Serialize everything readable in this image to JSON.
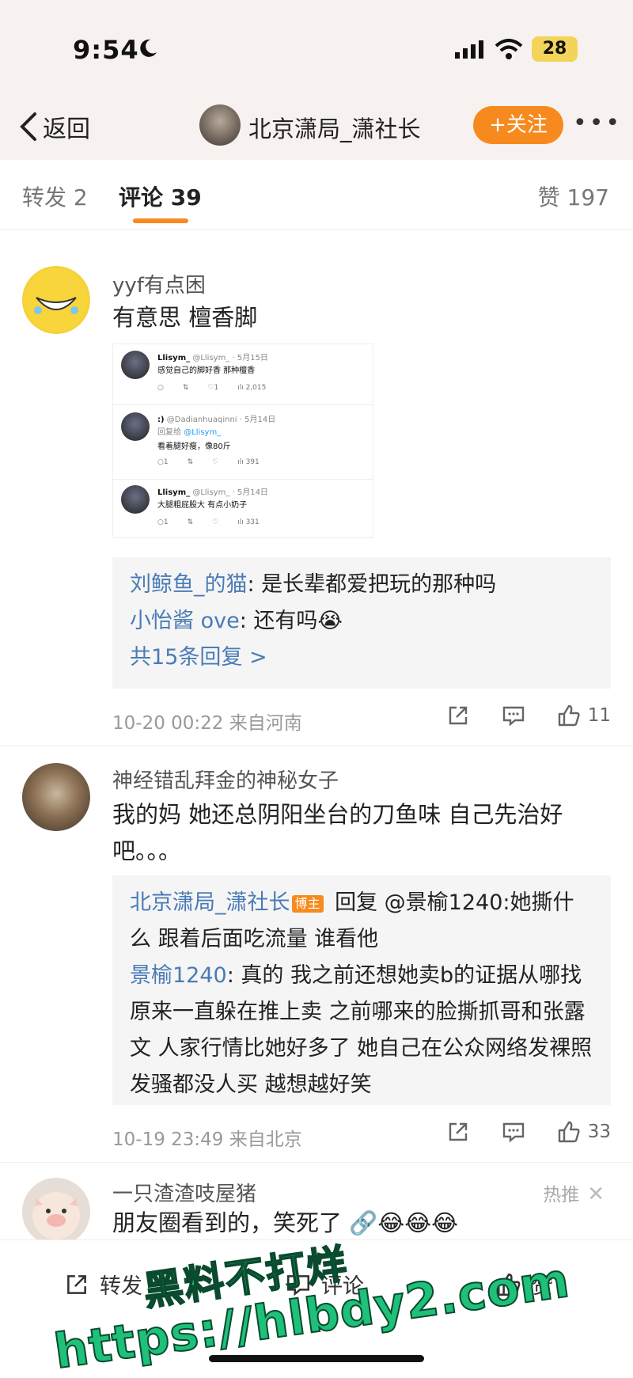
{
  "status_bar": {
    "time": "9:54",
    "battery": "28"
  },
  "nav": {
    "back_label": "返回",
    "title": "北京潇局_潇社长",
    "follow_label": "+关注",
    "more_label": "•••"
  },
  "tabs": {
    "repost": "转发 2",
    "comment": "评论 39",
    "like": "赞 197"
  },
  "comments": [
    {
      "username": "yyf有点困",
      "text": "有意思 檀香脚",
      "tweet": {
        "rows": [
          {
            "header": "Llisym_",
            "handle": "@Llisym_ · 5月15日",
            "body": "感觉自己的脚好香 那种檀香",
            "stats": [
              "○",
              "⇅",
              "♡1",
              "ılı 2,015"
            ]
          },
          {
            "header": ":)",
            "handle": "@Dadianhuaqinni · 5月14日",
            "reply_to_label": "回复给",
            "reply_to": "@Llisym_",
            "body": "看着腿好瘦，像80斤",
            "stats": [
              "○1",
              "⇅",
              "♡",
              "ılı 391"
            ]
          },
          {
            "header": "Llisym_",
            "handle": "@Llisym_ · 5月14日",
            "body": "大腿粗屁股大 有点小奶子",
            "stats": [
              "○1",
              "⇅",
              "♡",
              "ılı 331"
            ]
          }
        ]
      },
      "replies": [
        {
          "user": "刘鲸鱼_的猫",
          "text": ": 是长辈都爱把玩的那种吗"
        },
        {
          "user": "小怡酱 ove",
          "text": ": 还有吗😭"
        }
      ],
      "more_replies": "共15条回复 >",
      "meta": "10-20 00:22  来自河南",
      "likes": "11"
    },
    {
      "username": "神经错乱拜金的神秘女子",
      "text": "我的妈 她还总阴阳坐台的刀鱼味 自己先治好吧。。。",
      "replies": [
        {
          "user": "北京潇局_潇社长",
          "badge": "博主",
          "text": " 回复 @景榆1240:她撕什么 跟着后面吃流量 谁看他"
        },
        {
          "user": "景榆1240",
          "text": ": 真的 我之前还想她卖b的证据从哪找 原来一直躲在推上卖  之前哪来的脸撕抓哥和张露文   人家行情比她好多了  她自己在公众网络发裸照发骚都没人买 越想越好笑"
        }
      ],
      "meta": "10-19 23:49  来自北京",
      "likes": "33"
    },
    {
      "username": "一只渣渣吱屋猪",
      "text": "朋友圈看到的，笑死了 🔗😂😂😂",
      "hot_tag": "热推"
    }
  ],
  "bottom_bar": {
    "repost": "转发",
    "comment": "评论",
    "like": "赞"
  },
  "watermark": {
    "line1": "黑料不打烊",
    "line2": "https://hlbdy2.com"
  },
  "colors": {
    "accent": "#f78a1e",
    "link": "#4a7bb5",
    "watermark": "#1ec07a"
  }
}
